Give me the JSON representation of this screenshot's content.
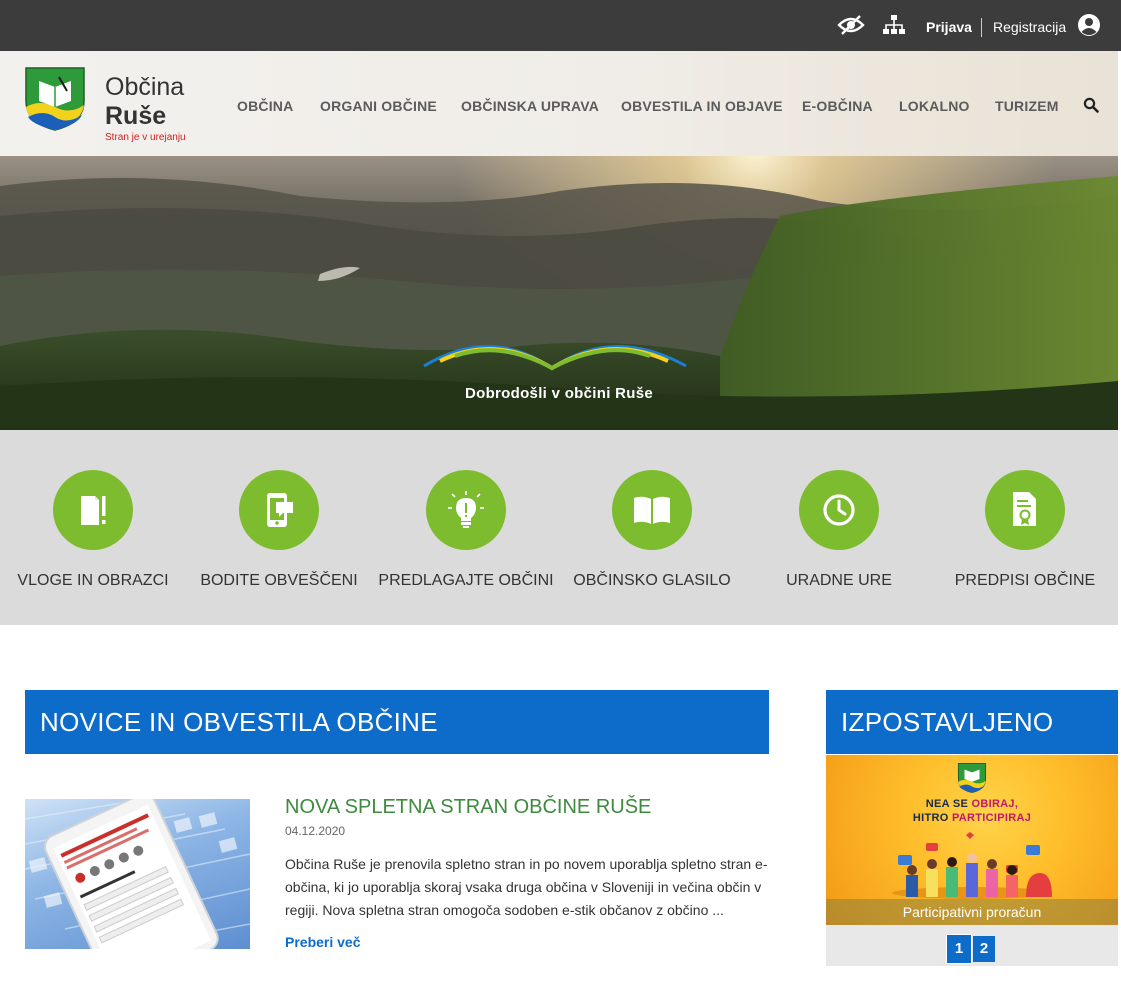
{
  "topbar": {
    "login": "Prijava",
    "register": "Registracija",
    "icons": [
      "accessibility-eye-icon",
      "sitemap-icon",
      "user-account-icon"
    ]
  },
  "logo": {
    "line1": "Občina",
    "line2": "Ruše",
    "subtitle": "Stran je v urejanju"
  },
  "nav": {
    "items": [
      "OBČINA",
      "ORGANI OBČINE",
      "OBČINSKA UPRAVA",
      "OBVESTILA IN OBJAVE",
      "E-OBČINA",
      "LOKALNO",
      "TURIZEM"
    ]
  },
  "hero": {
    "welcome": "Dobrodošli v občini Ruše"
  },
  "quick_links": [
    {
      "label": "VLOGE IN OBRAZCI",
      "icon": "documents-icon"
    },
    {
      "label": "BODITE OBVEŠČENI",
      "icon": "mobile-message-icon"
    },
    {
      "label": "PREDLAGAJTE OBČINI",
      "icon": "lightbulb-icon"
    },
    {
      "label": "OBČINSKO GLASILO",
      "icon": "open-book-icon"
    },
    {
      "label": "URADNE URE",
      "icon": "clock-icon"
    },
    {
      "label": "PREDPISI OBČINE",
      "icon": "certificate-document-icon"
    }
  ],
  "news": {
    "section_title": "NOVICE IN OBVESTILA OBČINE",
    "item": {
      "title": "NOVA SPLETNA STRAN OBČINE RUŠE",
      "date": "04.12.2020",
      "text": "Občina Ruše je prenovila spletno stran in po novem uporablja spletno stran e-občina, ki jo uporablja skoraj vsaka druga občina v Sloveniji in večina občin v regiji. Nova spletna stran omogoča sodoben e-stik občanov z občino ...",
      "more": "Preberi več"
    }
  },
  "featured": {
    "section_title": "IZPOSTAVLJENO",
    "banner_line1_a": "NEA SE ",
    "banner_line1_b": "OBIRAJ,",
    "banner_line2_a": "HITRO ",
    "banner_line2_b": "PARTICIPIRAJ",
    "caption": "Participativni proračun",
    "pages": [
      "1",
      "2"
    ]
  },
  "colors": {
    "topbar": "#3d3c3c",
    "accent_green": "#7dbb2f",
    "accent_blue": "#0d6bc9",
    "news_title_green": "#3e8a3e",
    "quick_links_bg": "#dcdbdb"
  }
}
